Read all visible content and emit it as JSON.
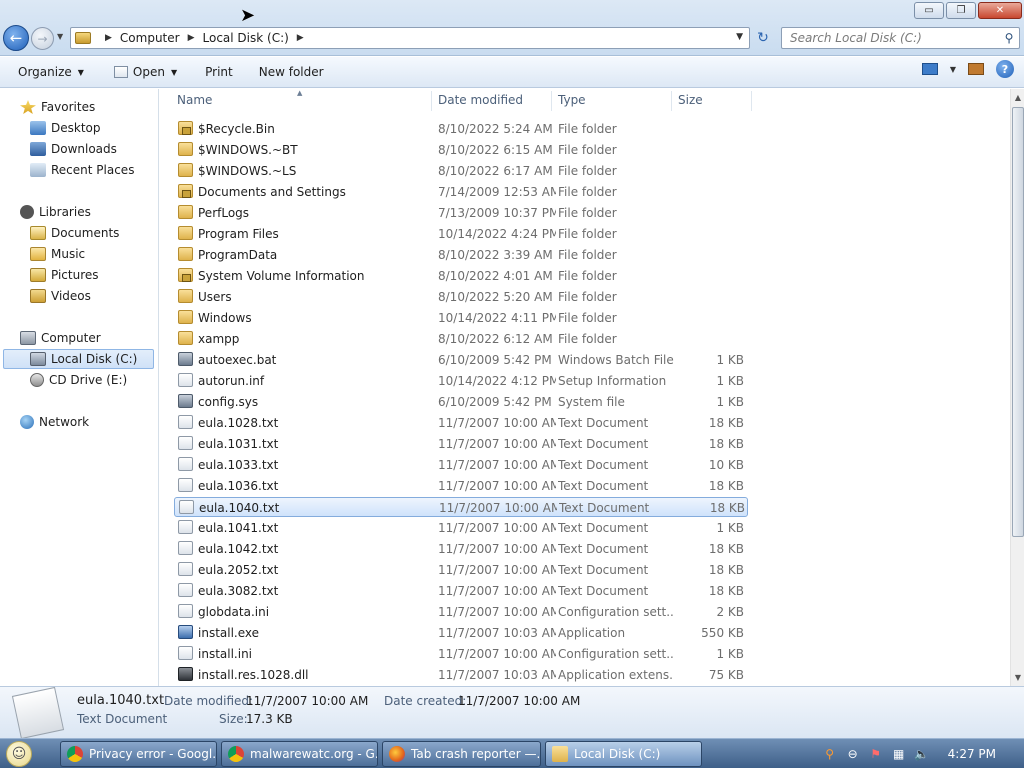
{
  "window": {
    "controls": {
      "minimize": "▭",
      "maximize": "❐",
      "close": "✕"
    }
  },
  "address": {
    "crumbs": [
      "Computer",
      "Local Disk (C:)"
    ],
    "search_placeholder": "Search Local Disk (C:)"
  },
  "toolbar": {
    "organize": "Organize",
    "open": "Open",
    "print": "Print",
    "new_folder": "New folder"
  },
  "nav": {
    "favorites": "Favorites",
    "desktop": "Desktop",
    "downloads": "Downloads",
    "recent_places": "Recent Places",
    "libraries": "Libraries",
    "documents": "Documents",
    "music": "Music",
    "pictures": "Pictures",
    "videos": "Videos",
    "computer": "Computer",
    "local_disk": "Local Disk (C:)",
    "cd_drive": "CD Drive (E:)",
    "network": "Network"
  },
  "columns": {
    "name": "Name",
    "date": "Date modified",
    "type": "Type",
    "size": "Size"
  },
  "files": [
    {
      "name": "$Recycle.Bin",
      "date": "8/10/2022 5:24 AM",
      "type": "File folder",
      "size": "",
      "icon": "folder-lock-icon"
    },
    {
      "name": "$WINDOWS.~BT",
      "date": "8/10/2022 6:15 AM",
      "type": "File folder",
      "size": "",
      "icon": "folder-icon"
    },
    {
      "name": "$WINDOWS.~LS",
      "date": "8/10/2022 6:17 AM",
      "type": "File folder",
      "size": "",
      "icon": "folder-icon"
    },
    {
      "name": "Documents and Settings",
      "date": "7/14/2009 12:53 AM",
      "type": "File folder",
      "size": "",
      "icon": "folder-lock-icon"
    },
    {
      "name": "PerfLogs",
      "date": "7/13/2009 10:37 PM",
      "type": "File folder",
      "size": "",
      "icon": "folder-icon"
    },
    {
      "name": "Program Files",
      "date": "10/14/2022 4:24 PM",
      "type": "File folder",
      "size": "",
      "icon": "folder-icon"
    },
    {
      "name": "ProgramData",
      "date": "8/10/2022 3:39 AM",
      "type": "File folder",
      "size": "",
      "icon": "folder-icon"
    },
    {
      "name": "System Volume Information",
      "date": "8/10/2022 4:01 AM",
      "type": "File folder",
      "size": "",
      "icon": "folder-lock-icon"
    },
    {
      "name": "Users",
      "date": "8/10/2022 5:20 AM",
      "type": "File folder",
      "size": "",
      "icon": "folder-icon"
    },
    {
      "name": "Windows",
      "date": "10/14/2022 4:11 PM",
      "type": "File folder",
      "size": "",
      "icon": "folder-icon"
    },
    {
      "name": "xampp",
      "date": "8/10/2022 6:12 AM",
      "type": "File folder",
      "size": "",
      "icon": "folder-icon"
    },
    {
      "name": "autoexec.bat",
      "date": "6/10/2009 5:42 PM",
      "type": "Windows Batch File",
      "size": "1 KB",
      "icon": "batch-file-icon"
    },
    {
      "name": "autorun.inf",
      "date": "10/14/2022 4:12 PM",
      "type": "Setup Information",
      "size": "1 KB",
      "icon": "file-icon"
    },
    {
      "name": "config.sys",
      "date": "6/10/2009 5:42 PM",
      "type": "System file",
      "size": "1 KB",
      "icon": "system-file-icon"
    },
    {
      "name": "eula.1028.txt",
      "date": "11/7/2007 10:00 AM",
      "type": "Text Document",
      "size": "18 KB",
      "icon": "text-file-icon"
    },
    {
      "name": "eula.1031.txt",
      "date": "11/7/2007 10:00 AM",
      "type": "Text Document",
      "size": "18 KB",
      "icon": "text-file-icon"
    },
    {
      "name": "eula.1033.txt",
      "date": "11/7/2007 10:00 AM",
      "type": "Text Document",
      "size": "10 KB",
      "icon": "text-file-icon"
    },
    {
      "name": "eula.1036.txt",
      "date": "11/7/2007 10:00 AM",
      "type": "Text Document",
      "size": "18 KB",
      "icon": "text-file-icon"
    },
    {
      "name": "eula.1040.txt",
      "date": "11/7/2007 10:00 AM",
      "type": "Text Document",
      "size": "18 KB",
      "icon": "text-file-icon",
      "selected": true
    },
    {
      "name": "eula.1041.txt",
      "date": "11/7/2007 10:00 AM",
      "type": "Text Document",
      "size": "1 KB",
      "icon": "text-file-icon"
    },
    {
      "name": "eula.1042.txt",
      "date": "11/7/2007 10:00 AM",
      "type": "Text Document",
      "size": "18 KB",
      "icon": "text-file-icon"
    },
    {
      "name": "eula.2052.txt",
      "date": "11/7/2007 10:00 AM",
      "type": "Text Document",
      "size": "18 KB",
      "icon": "text-file-icon"
    },
    {
      "name": "eula.3082.txt",
      "date": "11/7/2007 10:00 AM",
      "type": "Text Document",
      "size": "18 KB",
      "icon": "text-file-icon"
    },
    {
      "name": "globdata.ini",
      "date": "11/7/2007 10:00 AM",
      "type": "Configuration sett...",
      "size": "2 KB",
      "icon": "config-file-icon"
    },
    {
      "name": "install.exe",
      "date": "11/7/2007 10:03 AM",
      "type": "Application",
      "size": "550 KB",
      "icon": "application-icon"
    },
    {
      "name": "install.ini",
      "date": "11/7/2007 10:00 AM",
      "type": "Configuration sett...",
      "size": "1 KB",
      "icon": "config-file-icon"
    },
    {
      "name": "install.res.1028.dll",
      "date": "11/7/2007 10:03 AM",
      "type": "Application extens...",
      "size": "75 KB",
      "icon": "dll-file-icon"
    }
  ],
  "details": {
    "name": "eula.1040.txt",
    "type": "Text Document",
    "modified_label": "Date modified:",
    "modified_value": "11/7/2007 10:00 AM",
    "created_label": "Date created:",
    "created_value": "11/7/2007 10:00 AM",
    "size_label": "Size:",
    "size_value": "17.3 KB"
  },
  "taskbar": {
    "tasks": [
      {
        "label": "Privacy error - Googl...",
        "icon": "chrome-icon"
      },
      {
        "label": "malwarewatc.org - G...",
        "icon": "chrome-icon"
      },
      {
        "label": "Tab crash reporter —...",
        "icon": "firefox-icon"
      },
      {
        "label": "Local Disk (C:)",
        "icon": "explorer-icon",
        "active": true
      }
    ],
    "clock": "4:27 PM"
  }
}
